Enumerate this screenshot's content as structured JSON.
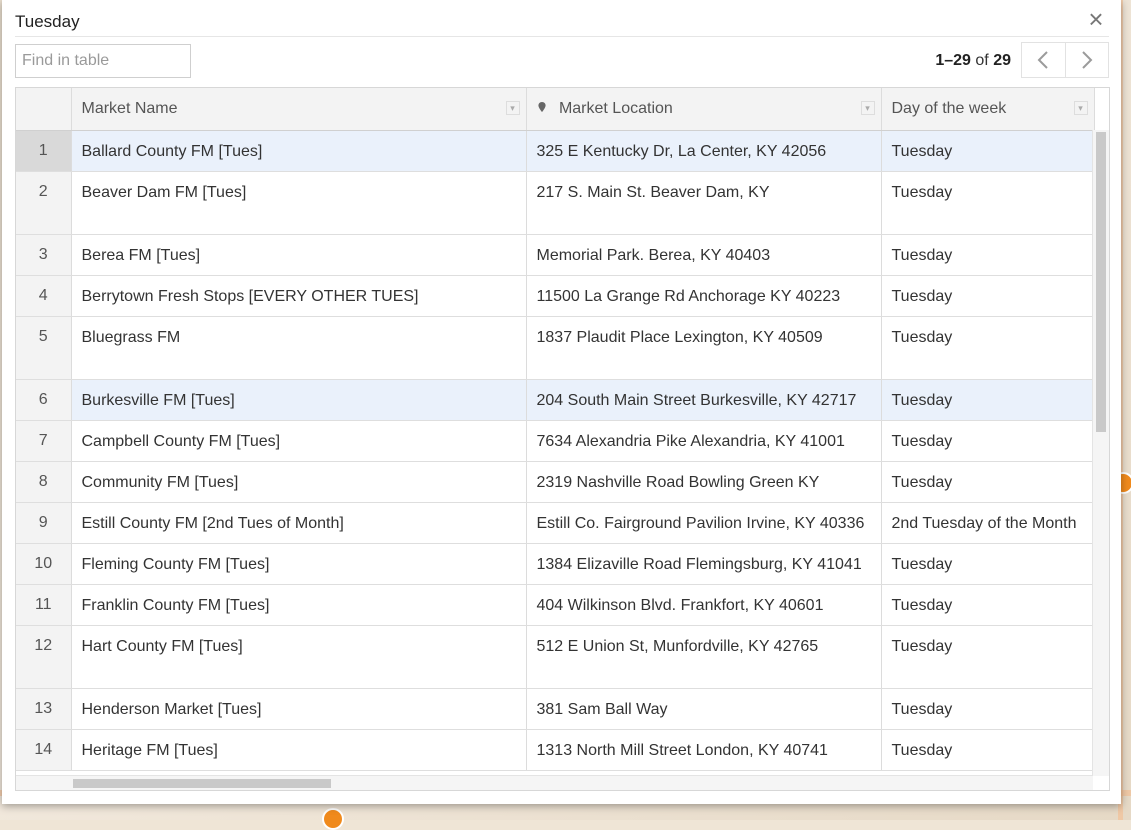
{
  "dialog": {
    "title": "Tuesday",
    "close_label": "×"
  },
  "search": {
    "placeholder": "Find in table",
    "value": ""
  },
  "pager": {
    "range": "1–29",
    "of": "of",
    "total": "29",
    "prev_label": "‹",
    "next_label": "›"
  },
  "table": {
    "columns": [
      "Market Name",
      "Market Location",
      "Day of the week"
    ],
    "rows": [
      {
        "num": "1",
        "name": "Ballard County FM [Tues]",
        "location": "325 E Kentucky Dr, La Center, KY 42056",
        "day": "Tuesday"
      },
      {
        "num": "2",
        "name": "Beaver Dam FM [Tues]",
        "location": "217 S. Main St. Beaver Dam, KY",
        "day": "Tuesday"
      },
      {
        "num": "3",
        "name": "Berea FM [Tues]",
        "location": "Memorial Park. Berea, KY 40403",
        "day": "Tuesday"
      },
      {
        "num": "4",
        "name": "Berrytown Fresh Stops [EVERY OTHER TUES]",
        "location": "11500 La Grange Rd Anchorage KY 40223",
        "day": "Tuesday"
      },
      {
        "num": "5",
        "name": "Bluegrass FM",
        "location": "1837 Plaudit Place Lexington, KY 40509",
        "day": "Tuesday"
      },
      {
        "num": "6",
        "name": "Burkesville FM [Tues]",
        "location": "204 South Main Street Burkesville, KY 42717",
        "day": "Tuesday"
      },
      {
        "num": "7",
        "name": "Campbell County FM [Tues]",
        "location": "7634 Alexandria Pike Alexandria, KY 41001",
        "day": "Tuesday"
      },
      {
        "num": "8",
        "name": "Community FM [Tues]",
        "location": "2319 Nashville Road Bowling Green KY",
        "day": "Tuesday"
      },
      {
        "num": "9",
        "name": "Estill County FM [2nd Tues of Month]",
        "location": "Estill Co. Fairground Pavilion Irvine, KY 40336",
        "day": "2nd Tuesday of the Month"
      },
      {
        "num": "10",
        "name": "Fleming County FM [Tues]",
        "location": "1384 Elizaville Road Flemingsburg, KY 41041",
        "day": "Tuesday"
      },
      {
        "num": "11",
        "name": "Franklin County FM [Tues]",
        "location": "404 Wilkinson Blvd. Frankfort, KY 40601",
        "day": "Tuesday"
      },
      {
        "num": "12",
        "name": "Hart County FM [Tues]",
        "location": "512 E Union St, Munfordville, KY 42765",
        "day": "Tuesday"
      },
      {
        "num": "13",
        "name": "Henderson Market [Tues]",
        "location": "381 Sam Ball Way",
        "day": "Tuesday"
      },
      {
        "num": "14",
        "name": "Heritage FM [Tues]",
        "location": "1313 North Mill Street London, KY 40741",
        "day": "Tuesday"
      }
    ]
  }
}
